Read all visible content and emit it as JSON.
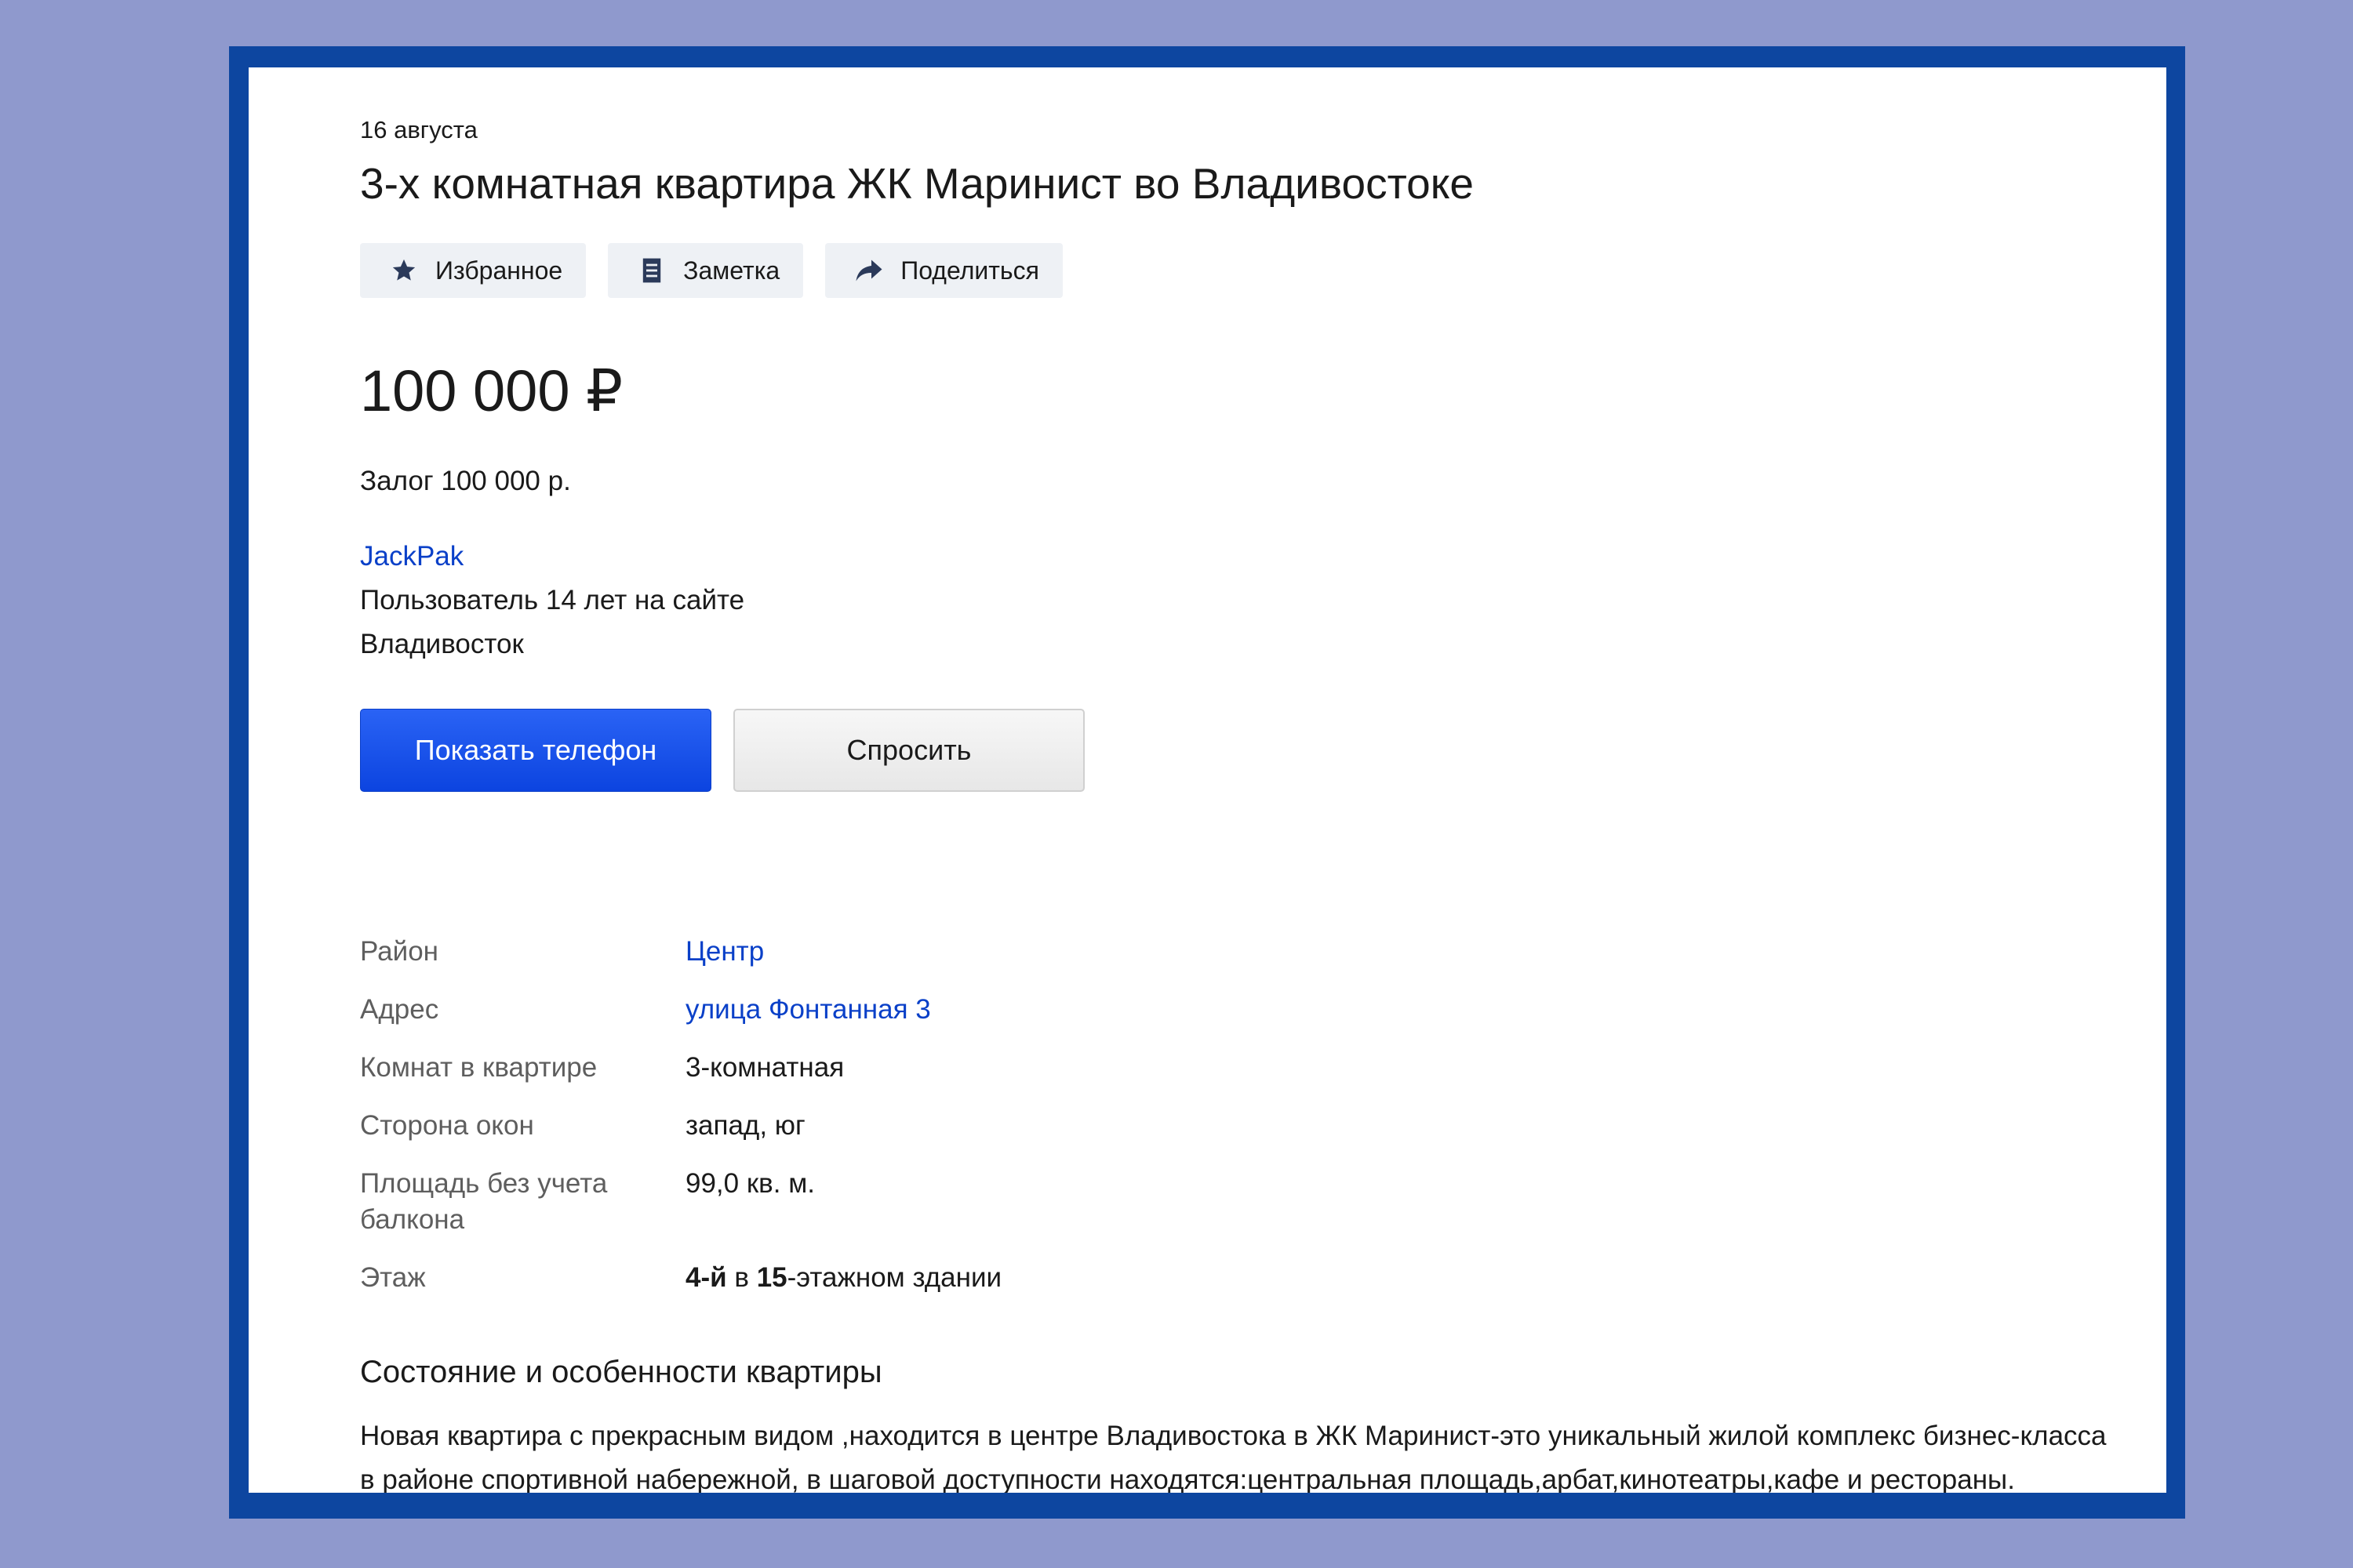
{
  "listing": {
    "date": "16 августа",
    "title": "3-х комнатная квартира ЖК Маринист во Владивостоке",
    "actions": {
      "favorite": "Избранное",
      "note": "Заметка",
      "share": "Поделиться"
    },
    "price": "100 000 ₽",
    "deposit": "Залог 100 000 р.",
    "seller": {
      "name": "JackPak",
      "tenure": "Пользователь 14 лет на сайте",
      "city": "Владивосток"
    },
    "buttons": {
      "show_phone": "Показать телефон",
      "ask": "Спросить"
    },
    "params": {
      "district_label": "Район",
      "district_value": "Центр",
      "address_label": "Адрес",
      "address_value": "улица Фонтанная 3",
      "rooms_label": "Комнат в квартире",
      "rooms_value": "3-комнатная",
      "windows_label": "Сторона окон",
      "windows_value": "запад, юг",
      "area_label": "Площадь без учета балкона",
      "area_value": "99,0 кв. м.",
      "floor_label": "Этаж",
      "floor_num": "4-й",
      "floor_mid": " в ",
      "floor_total": "15",
      "floor_suffix": "-этажном здании"
    },
    "section_title": "Состояние и особенности квартиры",
    "description": "Новая квартира с прекрасным видом ,находится в центре Владивостока в ЖК Маринист-это уникальный жилой комплекс бизнес-класса в районе спортивной набережной, в шаговой доступности находятся:центральная площадь,арбат,кинотеатры,кафе и рестораны."
  },
  "colors": {
    "background": "#8f99cd",
    "frame": "#0d46a0",
    "link": "#0a40c8",
    "primary_button": "#1048e8"
  },
  "icons": {
    "favorite": "star-icon",
    "note": "note-icon",
    "share": "share-arrow-icon"
  }
}
